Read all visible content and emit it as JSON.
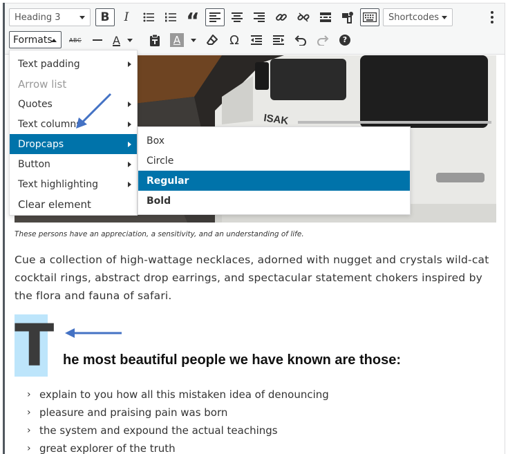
{
  "toolbar": {
    "block_format": "Heading 3",
    "shortcodes": "Shortcodes",
    "formats_label": "Formats",
    "bold_glyph": "B",
    "italic_glyph": "I",
    "quote_glyph": "“",
    "omega_glyph": "Ω",
    "help_glyph": "?",
    "strike_glyph": "ABC",
    "textcolor_glyph": "A"
  },
  "menu": {
    "items": [
      {
        "label": "Text padding"
      },
      {
        "label": "Arrow list"
      },
      {
        "label": "Quotes"
      },
      {
        "label": "Text columns"
      },
      {
        "label": "Dropcaps"
      },
      {
        "label": "Button"
      },
      {
        "label": "Text highlighting"
      },
      {
        "label": "Clear element"
      }
    ],
    "active_index": 4
  },
  "submenu": {
    "items": [
      {
        "label": "Box"
      },
      {
        "label": "Circle"
      },
      {
        "label": "Regular"
      },
      {
        "label": "Bold"
      }
    ],
    "active_index": 2
  },
  "content": {
    "caption": "These persons have an appreciation, a sensitivity, and an understanding of life.",
    "paragraph": "Cue a collection of high-wattage necklaces, adorned with nugget and crystals wild-cat cocktail rings, abstract drop earrings, and spectacular statement chokers inspired by the flora and fauna of safari.",
    "dropcap_letter": "T",
    "heading_rest": "he most beautiful people we have known are those:",
    "bullets": [
      "explain to you how all this mistaken idea of denouncing",
      "pleasure and praising pain was born",
      "the system and expound the actual teachings",
      "great explorer of the truth"
    ],
    "vehicle_text": "ISAK"
  },
  "colors": {
    "highlight": "#0073aa",
    "dropcap_bg": "#bde5fb",
    "annotation": "#4472c4"
  },
  "icons": [
    "bold-icon",
    "italic-icon",
    "bullet-list-icon",
    "numbered-list-icon",
    "blockquote-icon",
    "align-left-icon",
    "align-center-icon",
    "align-right-icon",
    "link-icon",
    "unlink-icon",
    "read-more-icon",
    "shortcode-insert-icon",
    "keyboard-icon",
    "more-vertical-icon",
    "strikethrough-icon",
    "horizontal-line-icon",
    "text-color-icon",
    "paste-text-icon",
    "background-color-icon",
    "clear-format-icon",
    "special-character-icon",
    "outdent-icon",
    "indent-icon",
    "undo-icon",
    "redo-icon",
    "help-icon"
  ]
}
